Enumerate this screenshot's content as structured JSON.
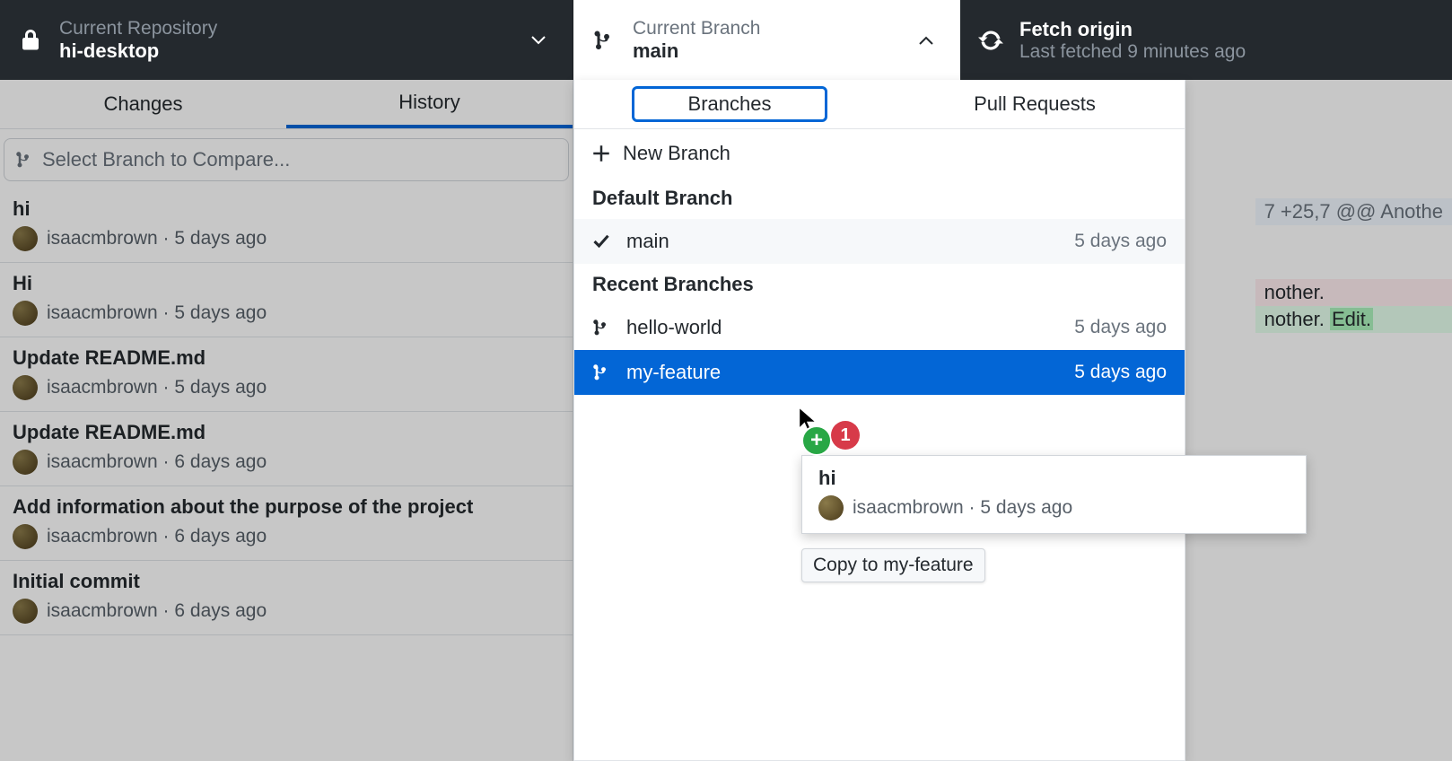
{
  "header": {
    "repo_label": "Current Repository",
    "repo_name": "hi-desktop",
    "branch_label": "Current Branch",
    "branch_name": "main",
    "fetch_label": "Fetch origin",
    "fetch_status": "Last fetched 9 minutes ago"
  },
  "tabs": {
    "changes": "Changes",
    "history": "History"
  },
  "compare_placeholder": "Select Branch to Compare...",
  "commits": [
    {
      "title": "hi",
      "author": "isaacmbrown",
      "time": "5 days ago"
    },
    {
      "title": "Hi",
      "author": "isaacmbrown",
      "time": "5 days ago"
    },
    {
      "title": "Update README.md",
      "author": "isaacmbrown",
      "time": "5 days ago"
    },
    {
      "title": "Update README.md",
      "author": "isaacmbrown",
      "time": "6 days ago"
    },
    {
      "title": "Add information about the purpose of the project",
      "author": "isaacmbrown",
      "time": "6 days ago"
    },
    {
      "title": "Initial commit",
      "author": "isaacmbrown",
      "time": "6 days ago"
    }
  ],
  "dropdown": {
    "tab_branches": "Branches",
    "tab_prs": "Pull Requests",
    "new_branch": "New Branch",
    "default_header": "Default Branch",
    "recent_header": "Recent Branches",
    "default": {
      "name": "main",
      "time": "5 days ago"
    },
    "recent": [
      {
        "name": "hello-world",
        "time": "5 days ago"
      },
      {
        "name": "my-feature",
        "time": "5 days ago"
      }
    ]
  },
  "drag": {
    "title": "hi",
    "author": "isaacmbrown",
    "time": "5 days ago",
    "count": "1",
    "tooltip": "Copy to my-feature"
  },
  "diff": {
    "hunk": "7 +25,7 @@ Anothe",
    "removed": "nother.",
    "added_pre": "nother. ",
    "added_tok": "Edit."
  }
}
